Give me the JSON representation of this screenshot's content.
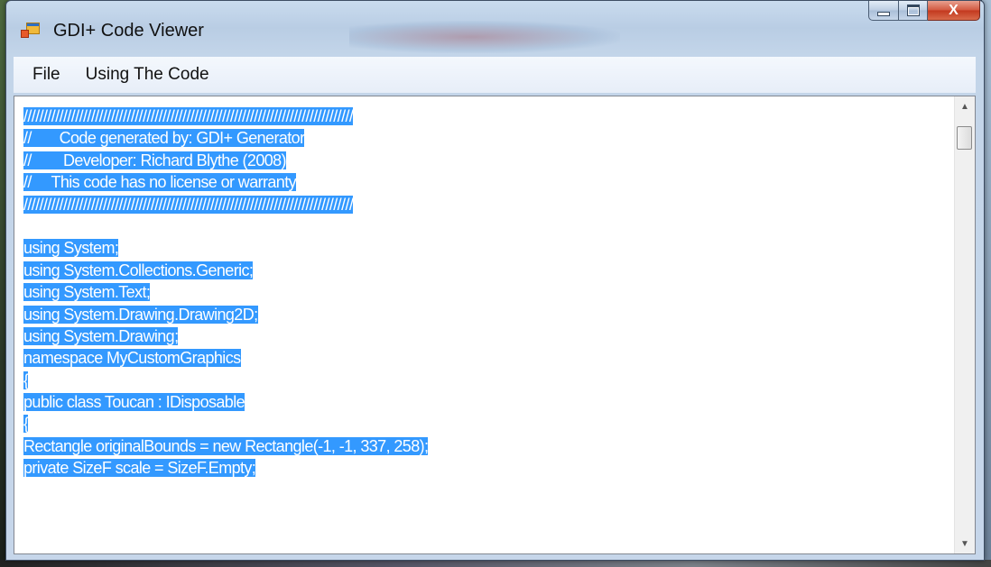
{
  "window": {
    "title": "GDI+ Code Viewer"
  },
  "menu": {
    "items": [
      "File",
      "Using The Code"
    ]
  },
  "editor": {
    "selected": true,
    "selection_color": "#3399ff",
    "lines": [
      "///////////////////////////////////////////////////////////////////////////////////",
      "//       Code generated by: GDI+ Generator",
      "//        Developer: Richard Blythe (2008)",
      "//     This code has no license or warranty",
      "///////////////////////////////////////////////////////////////////////////////////",
      "",
      "using System;",
      "using System.Collections.Generic;",
      "using System.Text;",
      "using System.Drawing.Drawing2D;",
      "using System.Drawing;",
      "namespace MyCustomGraphics",
      "{",
      "public class Toucan : IDisposable",
      "{",
      "Rectangle originalBounds = new Rectangle(-1, -1, 337, 258);",
      "private SizeF scale = SizeF.Empty;"
    ]
  },
  "icons": {
    "app": "app-window-icon",
    "minimize": "minimize-icon",
    "maximize": "maximize-icon",
    "close": "close-icon",
    "scroll_up": "scroll-up-arrow-icon",
    "scroll_down": "scroll-down-arrow-icon"
  },
  "caption": {
    "close_glyph": "X"
  }
}
